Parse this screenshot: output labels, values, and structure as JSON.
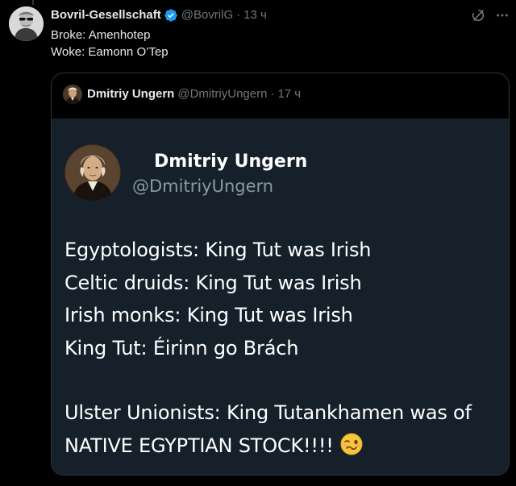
{
  "post": {
    "author": {
      "display_name": "Bovril-Gesellschaft",
      "handle": "@BovrilG",
      "time": "13 ч",
      "verified": true
    },
    "text_lines": [
      "Broke: Amenhotep",
      "Woke: Eamonn O’Tep"
    ],
    "icons": {
      "grok": "grok-icon",
      "more": "more-icon"
    }
  },
  "quote": {
    "author": {
      "display_name": "Dmitriy Ungern",
      "handle": "@DmitriyUngern",
      "time": "17 ч"
    },
    "card": {
      "name": "Dmitriy Ungern",
      "handle": "@DmitriyUngern",
      "lines": [
        "Egyptologists: King Tut was Irish",
        "Celtic druids: King Tut was Irish",
        "Irish monks: King Tut was Irish",
        "King Tut: Éirinn go Brách",
        "Ulster Unionists: King Tutankhamen was of",
        "NATIVE EGYPTIAN STOCK!!!!"
      ],
      "emoji": "woozy-face"
    }
  },
  "colors": {
    "background": "#000000",
    "card_background": "#15202b",
    "verified_blue": "#1d9bf0",
    "muted_text": "#71767b",
    "border": "#2f3336"
  }
}
